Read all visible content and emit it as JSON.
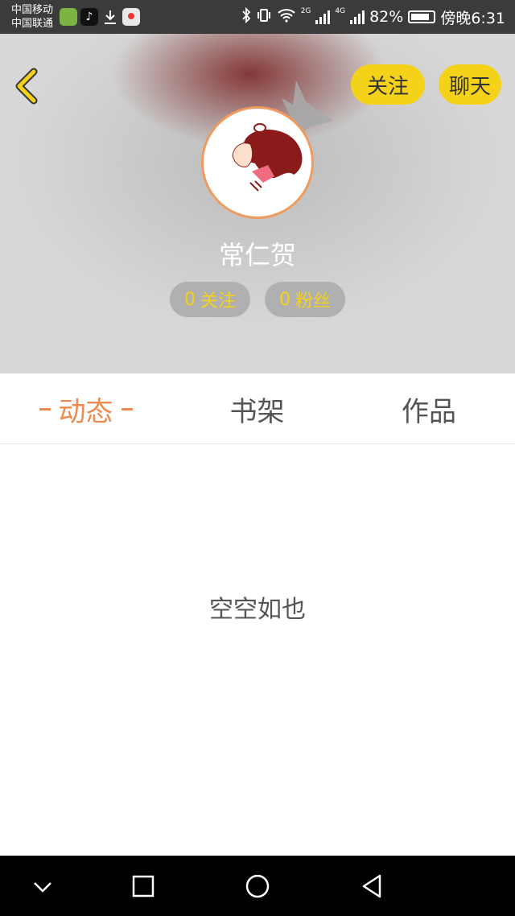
{
  "status_bar": {
    "carrier_1": "中国移动",
    "carrier_2": "中国联通",
    "network_2g": "2G",
    "network_4g": "4G",
    "battery_percent": "82%",
    "battery_level": 0.82,
    "time": "傍晚6:31"
  },
  "header": {
    "follow_label": "关注",
    "chat_label": "聊天",
    "username": "常仁贺",
    "following_count": "0",
    "following_label": "关注",
    "fans_count": "0",
    "fans_label": "粉丝"
  },
  "tabs": {
    "dynamic": "动态",
    "bookshelf": "书架",
    "works": "作品"
  },
  "content": {
    "empty_text": "空空如也"
  },
  "colors": {
    "accent_yellow": "#f5d21a",
    "active_tab": "#ee8a4f",
    "avatar_border": "#ee9b60"
  }
}
